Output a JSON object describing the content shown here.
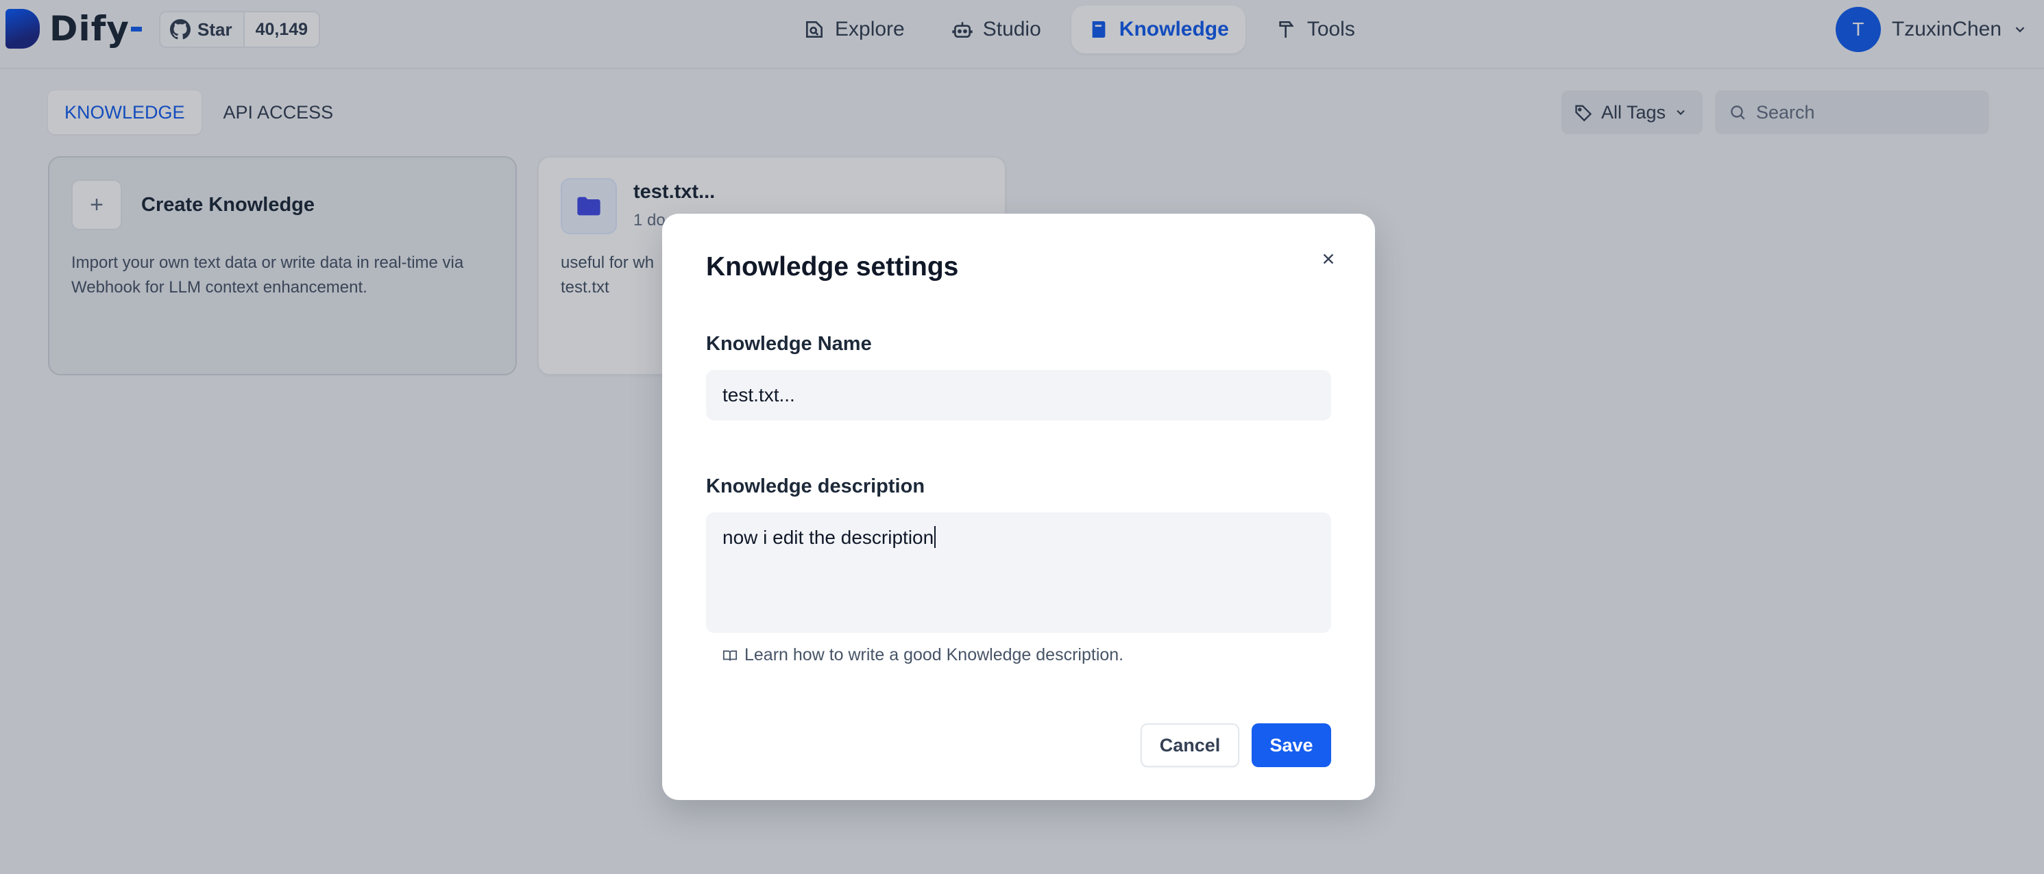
{
  "brand": {
    "name": "Dify"
  },
  "github": {
    "star_label": "Star",
    "count": "40,149"
  },
  "nav": [
    {
      "label": "Explore",
      "icon": "compass-icon"
    },
    {
      "label": "Studio",
      "icon": "robot-icon"
    },
    {
      "label": "Knowledge",
      "icon": "book-icon",
      "active": true
    },
    {
      "label": "Tools",
      "icon": "hammer-icon"
    }
  ],
  "user": {
    "initial": "T",
    "name": "TzuxinChen"
  },
  "tabs": [
    {
      "label": "KNOWLEDGE",
      "active": true
    },
    {
      "label": "API ACCESS"
    }
  ],
  "filters": {
    "tags_label": "All Tags",
    "search_placeholder": "Search"
  },
  "cards": {
    "create": {
      "title": "Create Knowledge",
      "description": "Import your own text data or write data in real-time via Webhook for LLM context enhancement."
    },
    "knowledge": {
      "title": "test.txt...",
      "subtitle": "1 do",
      "description_line1": "useful for wh",
      "description_line2": "test.txt"
    }
  },
  "modal": {
    "title": "Knowledge settings",
    "name_label": "Knowledge Name",
    "name_value": "test.txt...",
    "description_label": "Knowledge description",
    "description_value": "now i edit the description",
    "learn_link": "Learn how to write a good Knowledge description.",
    "cancel_label": "Cancel",
    "save_label": "Save"
  },
  "colors": {
    "accent": "#155eef",
    "overlay": "rgba(16,24,40,0.25)"
  }
}
